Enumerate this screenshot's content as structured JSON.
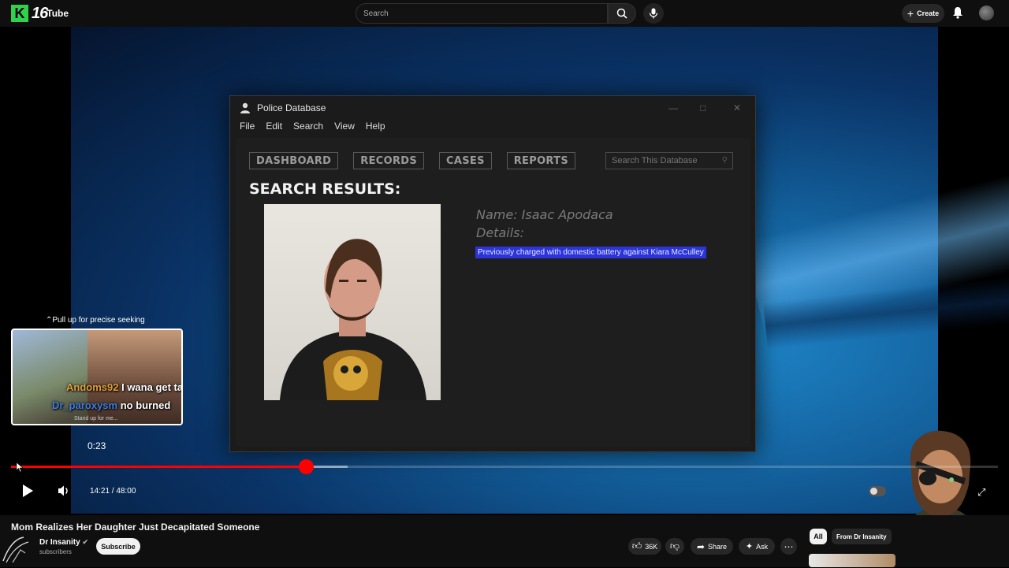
{
  "topbar": {
    "logo_text": "Tube",
    "logo_badge": "16",
    "search_placeholder": "Search",
    "create_label": "Create"
  },
  "window": {
    "title": "Police Database",
    "menu": [
      "File",
      "Edit",
      "Search",
      "View",
      "Help"
    ],
    "nav": [
      "DASHBOARD",
      "RECORDS",
      "CASES",
      "REPORTS"
    ],
    "search_placeholder": "Search This Database",
    "results_heading": "SEARCH RESULTS:",
    "name_label": "Name: Isaac Apodaca",
    "details_label": "Details:",
    "details_text": "Previously charged with domestic battery against Kiara McCulley"
  },
  "seek": {
    "hint": "Pull up for precise seeking",
    "preview_time": "0:23",
    "chat": [
      {
        "user": "Andoms92",
        "text": "I wana get tazerd in hospice",
        "user_color": "#e0a03a"
      },
      {
        "user": "Dr_paroxysm",
        "text": "no burned",
        "user_color": "#3a7de0"
      }
    ],
    "preview_caption": "Stand up for me..."
  },
  "player": {
    "current_time": "14:21",
    "duration": "48:00",
    "time_display": "14:21 / 48:00",
    "played_fraction": 0.299,
    "buffered_fraction": 0.341
  },
  "video_info": {
    "title": "Mom Realizes Her Daughter Just Decapitated Someone",
    "channel": "Dr Insanity",
    "subscribers": "subscribers",
    "subscribe_label": "Subscribe",
    "likes": "36K",
    "share_label": "Share",
    "ask_label": "Ask"
  },
  "sidebar_chips": {
    "all": "All",
    "from": "From Dr Insanity"
  },
  "colors": {
    "accent_red": "#ff0000",
    "highlight_blue": "#2b34d8",
    "logo_green": "#2fd24a"
  }
}
